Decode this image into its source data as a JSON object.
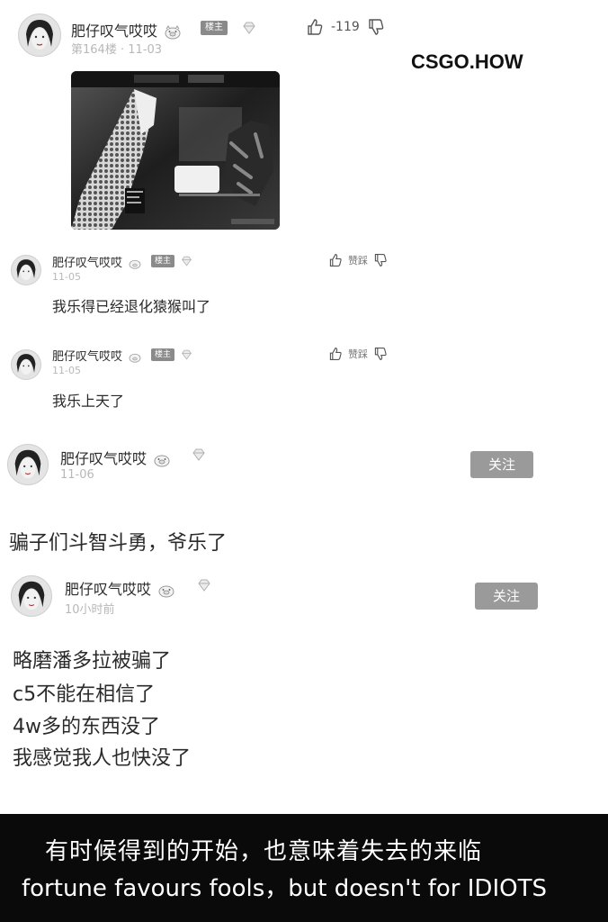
{
  "watermark": "CSGO.HOW",
  "post": {
    "username": "肥仔叹气哎哎",
    "role_badge": "楼主",
    "floor_time": "第164楼 · 11-03",
    "vote_count": "-119"
  },
  "replies": [
    {
      "username": "肥仔叹气哎哎",
      "role_badge": "楼主",
      "time": "11-05",
      "text": "我乐得已经退化猿猴叫了",
      "like_label": "赞踩"
    },
    {
      "username": "肥仔叹气哎哎",
      "role_badge": "楼主",
      "time": "11-05",
      "text": "我乐上天了",
      "like_label": "赞踩"
    }
  ],
  "posts": [
    {
      "username": "肥仔叹气哎哎",
      "time": "11-06",
      "follow_label": "关注",
      "text_lines": [
        "骗子们斗智斗勇，爷乐了"
      ]
    },
    {
      "username": "肥仔叹气哎哎",
      "time": "10小时前",
      "follow_label": "关注",
      "text_lines": [
        "略磨潘多拉被骗了",
        "c5不能在相信了",
        "4w多的东西没了",
        "我感觉我人也快没了"
      ]
    }
  ],
  "caption": {
    "cn": "有时候得到的开始，也意味着失去的来临",
    "en": "fortune favours fools，but doesn't for IDIOTS"
  },
  "colors": {
    "follow_bg": "#9a9a9a",
    "caption_bg": "#0a0a0a",
    "badge_bg": "#8a8a8a"
  },
  "icons": [
    "thumb-up-icon",
    "thumb-down-icon",
    "gem-icon",
    "pig-emoji-icon"
  ]
}
